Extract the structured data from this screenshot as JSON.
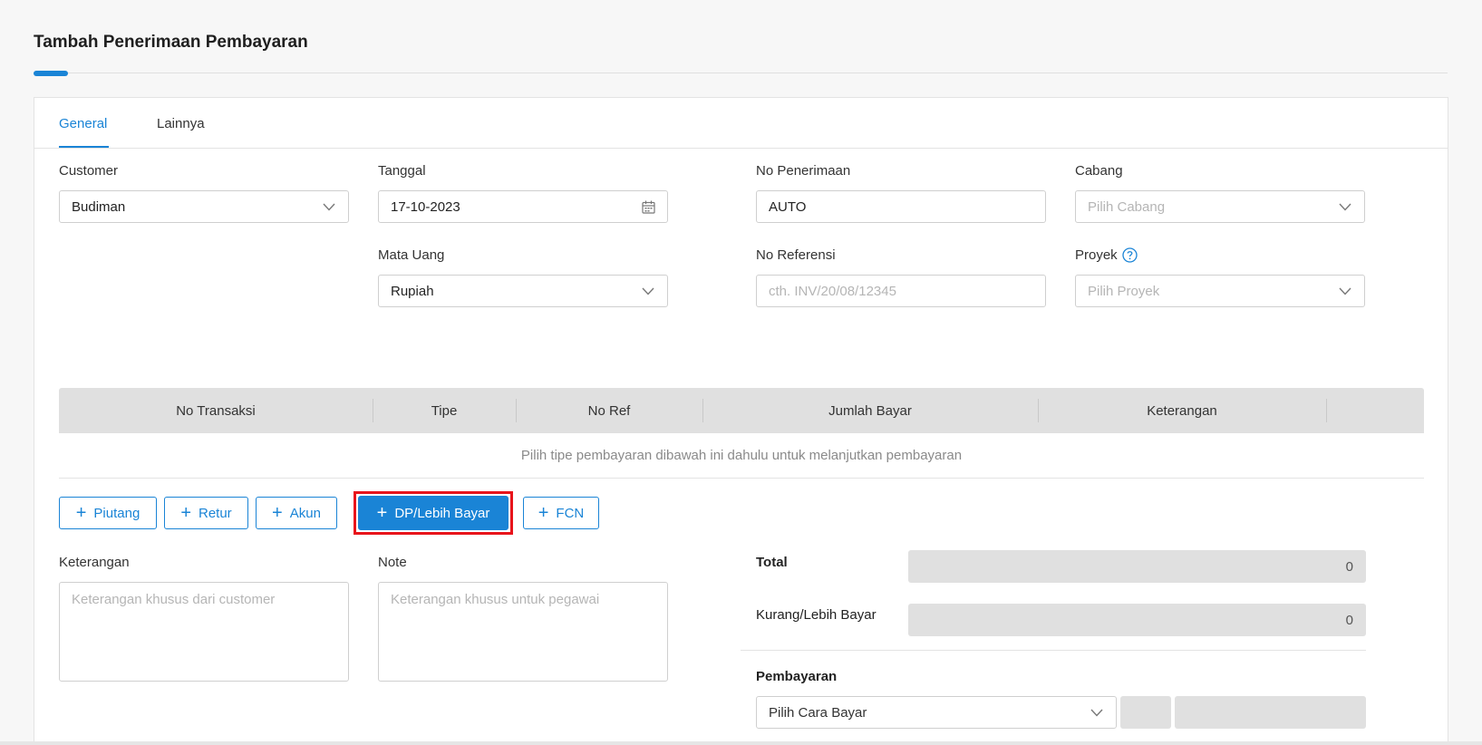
{
  "page": {
    "title": "Tambah Penerimaan Pembayaran"
  },
  "tabs": [
    {
      "label": "General",
      "active": true
    },
    {
      "label": "Lainnya",
      "active": false
    }
  ],
  "form": {
    "customer": {
      "label": "Customer",
      "value": "Budiman",
      "icon": "chevron-down-icon"
    },
    "tanggal": {
      "label": "Tanggal",
      "value": "17-10-2023",
      "icon": "calendar-icon"
    },
    "no_penerimaan": {
      "label": "No Penerimaan",
      "value": "AUTO"
    },
    "cabang": {
      "label": "Cabang",
      "placeholder": "Pilih Cabang",
      "icon": "chevron-down-icon"
    },
    "mata_uang": {
      "label": "Mata Uang",
      "value": "Rupiah",
      "icon": "chevron-down-icon"
    },
    "no_referensi": {
      "label": "No Referensi",
      "placeholder": "cth. INV/20/08/12345"
    },
    "proyek": {
      "label": "Proyek",
      "placeholder": "Pilih Proyek",
      "help_icon": "question-circle-icon",
      "icon": "chevron-down-icon"
    }
  },
  "table": {
    "columns": [
      "No Transaksi",
      "Tipe",
      "No Ref",
      "Jumlah Bayar",
      "Keterangan"
    ],
    "empty_message": "Pilih tipe pembayaran dibawah ini dahulu untuk melanjutkan pembayaran"
  },
  "buttons": {
    "piutang": "Piutang",
    "retur": "Retur",
    "akun": "Akun",
    "dp_lebih_bayar": "DP/Lebih Bayar",
    "fcn": "FCN",
    "plus_symbol": "+"
  },
  "notes": {
    "keterangan": {
      "label": "Keterangan",
      "placeholder": "Keterangan khusus dari customer"
    },
    "note": {
      "label": "Note",
      "placeholder": "Keterangan khusus untuk pegawai"
    }
  },
  "summary": {
    "total": {
      "label": "Total",
      "value": "0"
    },
    "kurang_lebih": {
      "label": "Kurang/Lebih Bayar",
      "value": "0"
    },
    "pembayaran": {
      "label": "Pembayaran",
      "placeholder": "Pilih Cara Bayar"
    }
  },
  "colors": {
    "accent": "#1a84d6",
    "highlight": "#e8141b",
    "header_bg": "#e0e0e0"
  }
}
